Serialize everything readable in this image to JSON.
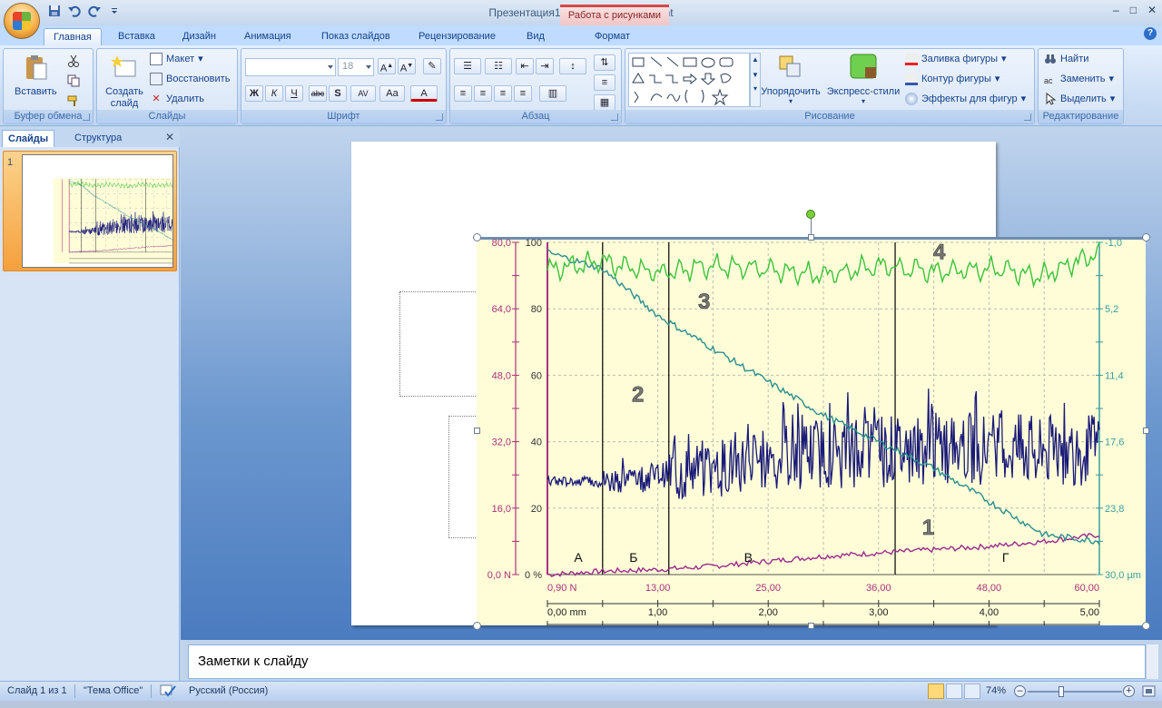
{
  "window": {
    "title": "Презентация1 - Microsoft PowerPoint",
    "contextual_tab_group": "Работа с рисунками",
    "controls": [
      "–",
      "□",
      "✕"
    ]
  },
  "qat": {
    "icons": [
      "save-icon",
      "undo-icon",
      "redo-icon",
      "customize-qat-icon"
    ]
  },
  "tabs": [
    "Главная",
    "Вставка",
    "Дизайн",
    "Анимация",
    "Показ слайдов",
    "Рецензирование",
    "Вид",
    "Формат"
  ],
  "active_tab": "Главная",
  "ribbon": {
    "clipboard": {
      "label": "Буфер обмена",
      "paste": "Вставить"
    },
    "slides": {
      "label": "Слайды",
      "new_slide": "Создать слайд",
      "layout": "Макет",
      "reset": "Восстановить",
      "delete": "Удалить"
    },
    "font": {
      "label": "Шрифт",
      "font_name": "",
      "font_size": "18",
      "buttons": [
        "Ж",
        "К",
        "Ч",
        "abc",
        "S",
        "AV",
        "Aa",
        "А"
      ]
    },
    "paragraph": {
      "label": "Абзац"
    },
    "drawing": {
      "label": "Рисование",
      "arrange": "Упорядочить",
      "quick_styles": "Экспресс-стили",
      "shape_fill": "Заливка фигуры",
      "shape_outline": "Контур фигуры",
      "shape_effects": "Эффекты для фигур"
    },
    "editing": {
      "label": "Редактирование",
      "find": "Найти",
      "replace": "Заменить",
      "select": "Выделить"
    }
  },
  "pane": {
    "tabs": [
      "Слайды",
      "Структура"
    ],
    "slide_number": "1"
  },
  "notes": {
    "text": "Заметки к слайду"
  },
  "status": {
    "slide_info": "Слайд 1 из 1",
    "theme": "\"Тема Office\"",
    "language": "Русский (Россия)",
    "zoom": "74%"
  },
  "chart_data": {
    "type": "line",
    "left_axis_outer": {
      "ticks": [
        "80,0",
        "64,0",
        "48,0",
        "32,0",
        "16,0",
        "0,0 N"
      ]
    },
    "left_axis_inner": {
      "ticks": [
        "100",
        "80",
        "60",
        "40",
        "20",
        "0 %"
      ]
    },
    "right_axis": {
      "ticks": [
        "-1,0",
        "5,2",
        "11,4",
        "17,6",
        "23,8",
        "30,0 µm"
      ]
    },
    "x_axis_top": {
      "ticks": [
        "0,90 N",
        "13,00",
        "25,00",
        "36,00",
        "48,00",
        "60,00"
      ]
    },
    "x_axis_bottom": {
      "ticks": [
        "0,00 mm",
        "1,00",
        "2,00",
        "3,00",
        "4,00",
        "5,00"
      ]
    },
    "ylim": [
      0,
      100
    ],
    "xlim": [
      0,
      5
    ],
    "curve_labels": [
      "1",
      "2",
      "3",
      "4"
    ],
    "region_labels": [
      "А",
      "Б",
      "В",
      "Г"
    ],
    "vertical_markers_mm": [
      0.5,
      1.1,
      3.15
    ],
    "series": [
      {
        "name": "1",
        "color": "#9b2b8e",
        "x": [
          0,
          0.5,
          1.0,
          1.5,
          2.0,
          2.5,
          3.0,
          3.5,
          4.0,
          4.5,
          5.0
        ],
        "y": [
          0,
          1,
          1.5,
          2.5,
          4,
          5.5,
          6.5,
          7.5,
          8.5,
          10,
          12
        ]
      },
      {
        "name": "2",
        "color": "#1a1a7a",
        "x": [
          0,
          0.5,
          1.0,
          1.5,
          2.0,
          2.5,
          3.0,
          3.5,
          4.0,
          4.5,
          5.0
        ],
        "y": [
          28,
          28,
          30,
          32,
          35,
          37,
          37,
          38,
          38,
          37,
          38
        ]
      },
      {
        "name": "3",
        "color": "#2a8f8f",
        "x": [
          0,
          0.5,
          1.0,
          1.5,
          2.0,
          2.5,
          3.0,
          3.5,
          4.0,
          4.5,
          5.0
        ],
        "y": [
          97,
          92,
          78,
          68,
          58,
          48,
          40,
          32,
          22,
          12,
          10
        ]
      },
      {
        "name": "4",
        "color": "#3cc23c",
        "x": [
          0,
          0.5,
          1.0,
          1.5,
          2.0,
          2.5,
          3.0,
          3.5,
          4.0,
          4.5,
          5.0
        ],
        "y": [
          92,
          94,
          91,
          93,
          92,
          90,
          93,
          91,
          92,
          90,
          97
        ]
      }
    ],
    "colors": {
      "background": "#fefdd8",
      "grid": "#b9bdb0",
      "left_axis": "#a8327a",
      "right_axis": "#3a9e9e"
    }
  }
}
